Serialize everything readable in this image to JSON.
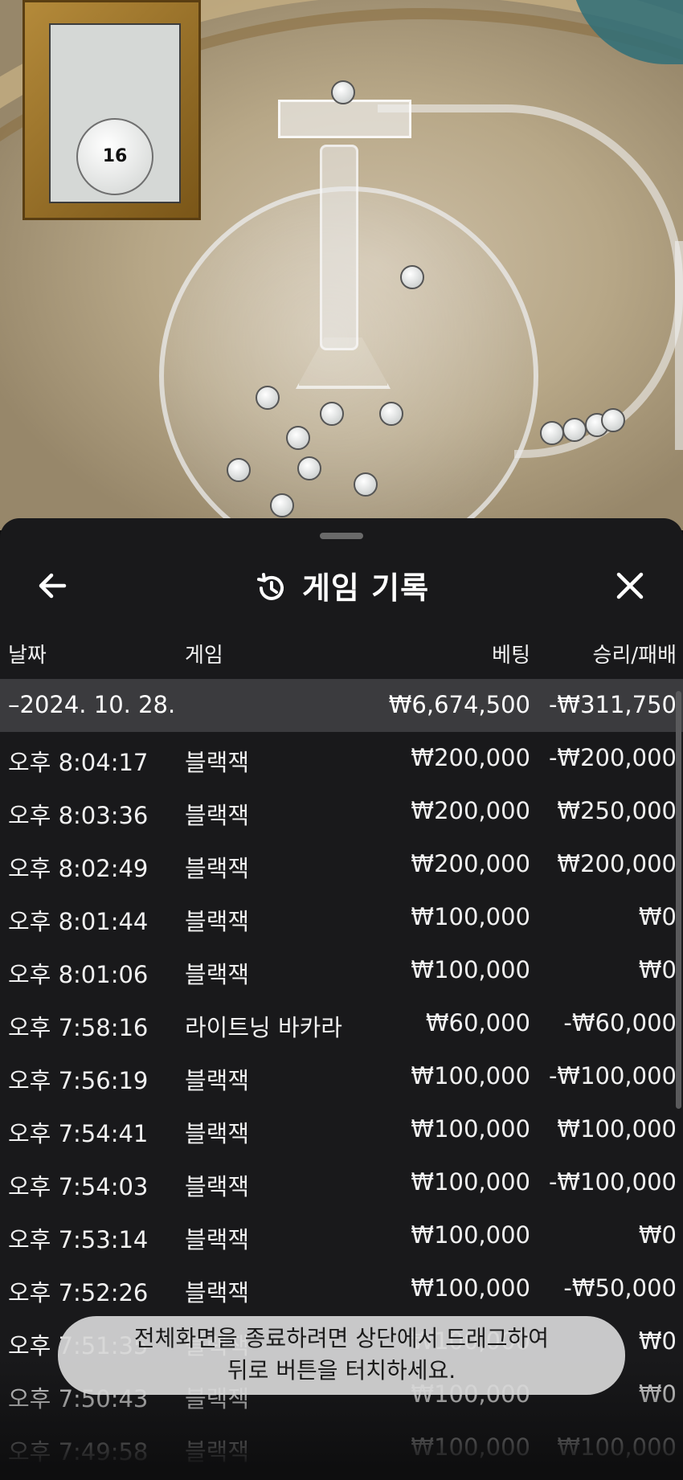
{
  "header": {
    "title": "게임 기록",
    "history_icon": "history-clock-icon",
    "back_icon": "arrow-left-icon",
    "close_icon": "close-x-icon"
  },
  "columns": {
    "date": "날짜",
    "game": "게임",
    "bet": "베팅",
    "result": "승리/패배"
  },
  "date_group": {
    "date": "–2024. 10. 28.",
    "bet_total": "₩6,674,500",
    "result_total": "-₩311,750"
  },
  "rows": [
    {
      "time": "오후 8:04:17",
      "game": "블랙잭",
      "bet": "₩200,000",
      "result": "-₩200,000"
    },
    {
      "time": "오후 8:03:36",
      "game": "블랙잭",
      "bet": "₩200,000",
      "result": "₩250,000"
    },
    {
      "time": "오후 8:02:49",
      "game": "블랙잭",
      "bet": "₩200,000",
      "result": "₩200,000"
    },
    {
      "time": "오후 8:01:44",
      "game": "블랙잭",
      "bet": "₩100,000",
      "result": "₩0"
    },
    {
      "time": "오후 8:01:06",
      "game": "블랙잭",
      "bet": "₩100,000",
      "result": "₩0"
    },
    {
      "time": "오후 7:58:16",
      "game": "라이트닝 바카라",
      "bet": "₩60,000",
      "result": "-₩60,000"
    },
    {
      "time": "오후 7:56:19",
      "game": "블랙잭",
      "bet": "₩100,000",
      "result": "-₩100,000"
    },
    {
      "time": "오후 7:54:41",
      "game": "블랙잭",
      "bet": "₩100,000",
      "result": "₩100,000"
    },
    {
      "time": "오후 7:54:03",
      "game": "블랙잭",
      "bet": "₩100,000",
      "result": "-₩100,000"
    },
    {
      "time": "오후 7:53:14",
      "game": "블랙잭",
      "bet": "₩100,000",
      "result": "₩0"
    },
    {
      "time": "오후 7:52:26",
      "game": "블랙잭",
      "bet": "₩100,000",
      "result": "-₩50,000"
    },
    {
      "time": "오후 7:51:35",
      "game": "블랙잭",
      "bet": "₩100,000",
      "result": "₩0"
    },
    {
      "time": "오후 7:50:43",
      "game": "블랙잭",
      "bet": "₩100,000",
      "result": "₩0"
    },
    {
      "time": "오후 7:49:58",
      "game": "블랙잭",
      "bet": "₩100,000",
      "result": "₩100,000"
    }
  ],
  "toast": {
    "line1": "전체화면을 종료하려면 상단에서 드래그하여",
    "line2": "뒤로 버튼을 터치하세요."
  },
  "background": {
    "monitor_ball_number": "16",
    "colors": {
      "sheet": "#19191b",
      "date_row": "#3b3b3e",
      "toast": "#d6d6d6"
    }
  }
}
